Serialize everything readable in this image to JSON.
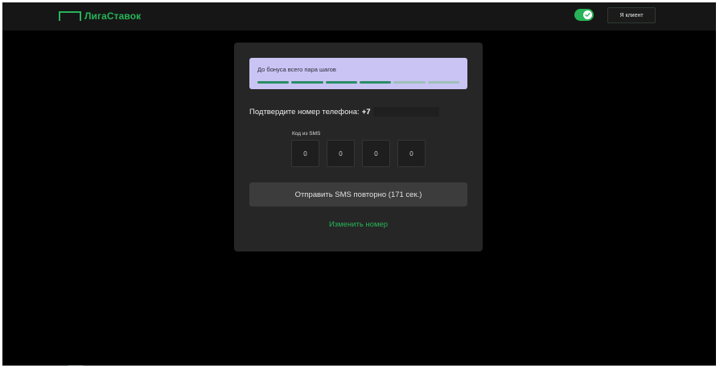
{
  "header": {
    "logo_text": "ЛигаСтавок",
    "client_button": "Я клиент"
  },
  "colors": {
    "accent": "#27b358",
    "banner": "#c9c4f4",
    "card": "#262626"
  },
  "progress": {
    "text": "До бонуса всего пара шагов",
    "total_steps": 6,
    "completed_steps": 4
  },
  "phone": {
    "label": "Подтвердите номер телефона:",
    "prefix": "+7"
  },
  "sms": {
    "label": "Код из SMS",
    "digits": [
      "0",
      "0",
      "0",
      "0"
    ]
  },
  "actions": {
    "resend": "Отправить SMS повторно (171 сек.)",
    "change_number": "Изменить номер"
  }
}
